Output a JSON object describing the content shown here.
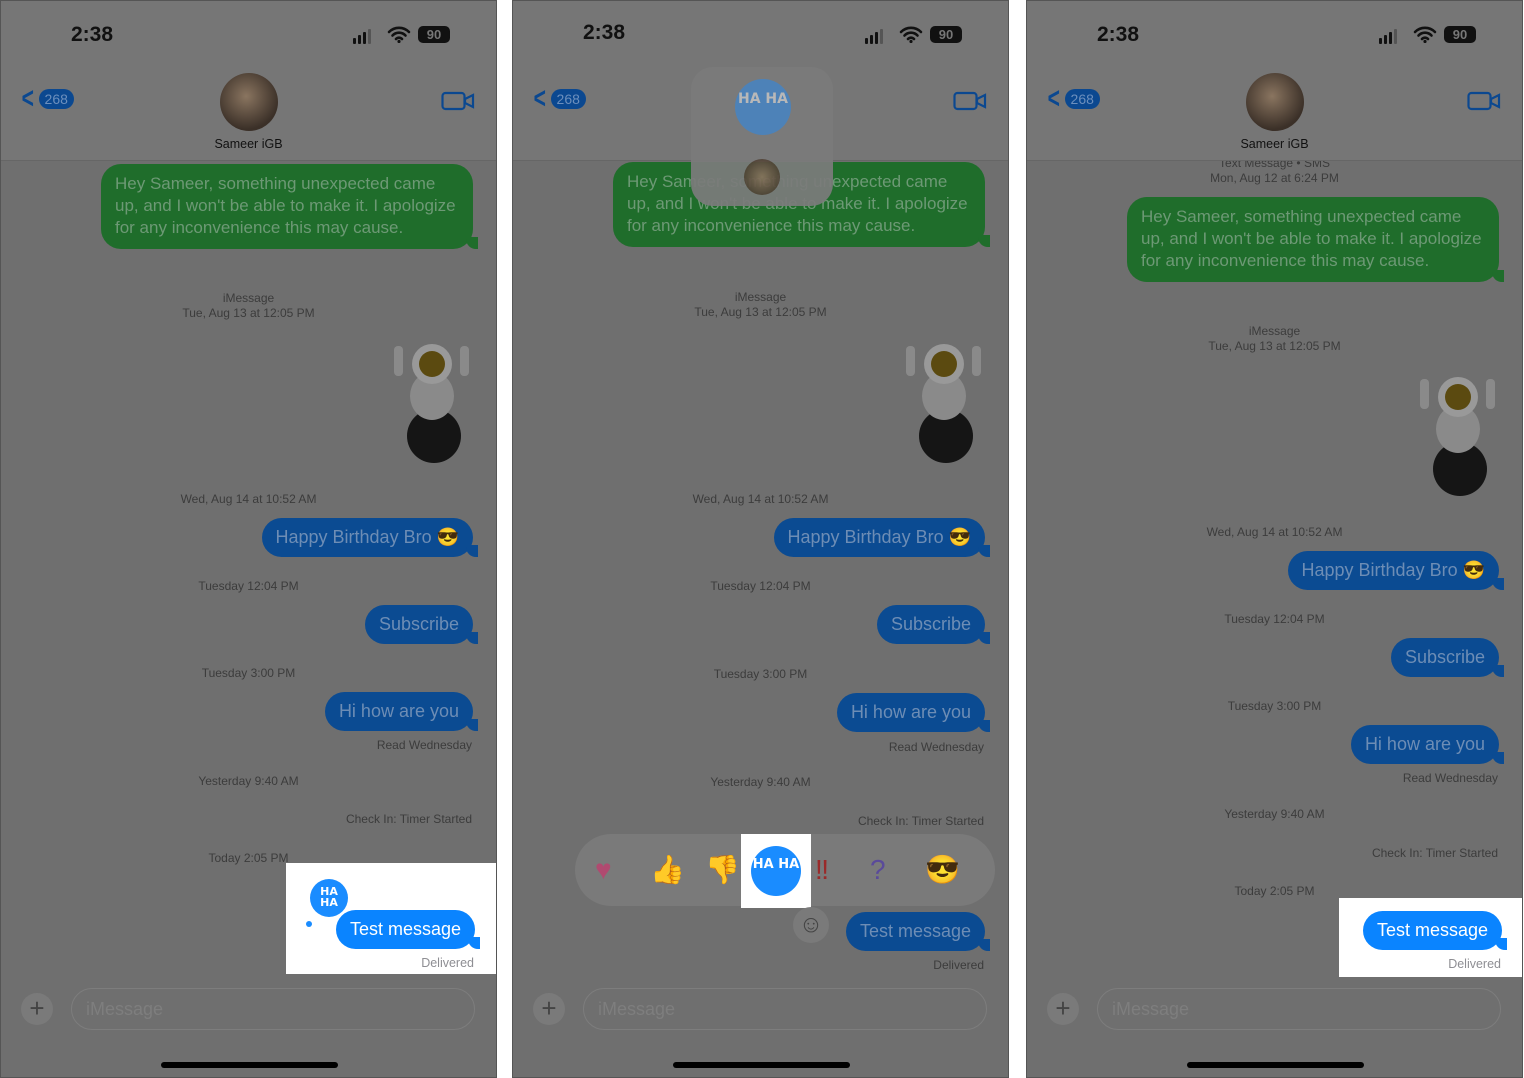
{
  "colors": {
    "imessage_blue": "#0a84ff",
    "sms_green": "#34c759",
    "dim_overlay": "#6f6f6f",
    "highlight": "#ffffff"
  },
  "panels": [
    {
      "status": {
        "time": "2:38",
        "battery": "90"
      },
      "header": {
        "back_count": "268",
        "contact": "Sameer iGB"
      },
      "items": [
        {
          "kind": "bubble",
          "color": "green",
          "text": "Hey Sameer, something unexpected came up, and I won't be able to make it. I apologize for any inconvenience this may cause."
        },
        {
          "kind": "ts",
          "text": "iMessage"
        },
        {
          "kind": "ts",
          "text": "Tue, Aug 13 at 12:05 PM"
        },
        {
          "kind": "sticker",
          "text": ""
        },
        {
          "kind": "ts",
          "text": "Wed, Aug 14 at 10:52 AM"
        },
        {
          "kind": "bubble",
          "color": "blue",
          "text": "Happy Birthday Bro 😎"
        },
        {
          "kind": "ts",
          "text": "Tuesday 12:04 PM"
        },
        {
          "kind": "bubble",
          "color": "blue",
          "text": "Subscribe"
        },
        {
          "kind": "ts",
          "text": "Tuesday 3:00 PM"
        },
        {
          "kind": "bubble",
          "color": "blue",
          "text": "Hi how are you"
        },
        {
          "kind": "st",
          "text": "Read Wednesday"
        },
        {
          "kind": "ts",
          "text": "Yesterday 9:40 AM"
        },
        {
          "kind": "st",
          "text": "Check In: Timer Started"
        },
        {
          "kind": "ts",
          "text": "Today 2:05 PM"
        }
      ],
      "highlight": {
        "message": "Test message",
        "status": "Delivered",
        "reaction": "HA HA",
        "reaction_icon": "haha-icon"
      },
      "input_placeholder": "iMessage"
    },
    {
      "status": {
        "time": "2:38",
        "battery": "90"
      },
      "header": {
        "back_count": "268",
        "contact": ""
      },
      "items": [
        {
          "kind": "bubble",
          "color": "green",
          "text": "Hey Sameer, something unexpected came up, and I won't be able to make it. I apologize for any inconvenience this may cause."
        },
        {
          "kind": "ts",
          "text": "iMessage"
        },
        {
          "kind": "ts",
          "text": "Tue, Aug 13 at 12:05 PM"
        },
        {
          "kind": "sticker",
          "text": ""
        },
        {
          "kind": "ts",
          "text": "Wed, Aug 14 at 10:52 AM"
        },
        {
          "kind": "bubble",
          "color": "blue",
          "text": "Happy Birthday Bro 😎"
        },
        {
          "kind": "ts",
          "text": "Tuesday 12:04 PM"
        },
        {
          "kind": "bubble",
          "color": "blue",
          "text": "Subscribe"
        },
        {
          "kind": "ts",
          "text": "Tuesday 3:00 PM"
        },
        {
          "kind": "bubble",
          "color": "blue",
          "text": "Hi how are you"
        },
        {
          "kind": "st",
          "text": "Read Wednesday"
        },
        {
          "kind": "ts",
          "text": "Yesterday 9:40 AM"
        },
        {
          "kind": "st",
          "text": "Check In: Timer Started"
        },
        {
          "kind": "bubble",
          "color": "blue",
          "text": "Test message"
        },
        {
          "kind": "st",
          "text": "Delivered"
        }
      ],
      "tapbacks": [
        {
          "icon": "heart-icon",
          "glyph": "♥"
        },
        {
          "icon": "thumbs-up-icon",
          "glyph": "👍"
        },
        {
          "icon": "thumbs-down-icon",
          "glyph": "👎"
        },
        {
          "icon": "haha-icon",
          "glyph": "HA HA",
          "selected": true
        },
        {
          "icon": "exclamation-icon",
          "glyph": "‼"
        },
        {
          "icon": "question-icon",
          "glyph": "?"
        },
        {
          "icon": "sunglasses-emoji-icon",
          "glyph": "😎"
        }
      ],
      "popup_reaction": "HA HA",
      "input_placeholder": "iMessage"
    },
    {
      "status": {
        "time": "2:38",
        "battery": "90"
      },
      "header": {
        "back_count": "268",
        "contact": "Sameer iGB"
      },
      "items": [
        {
          "kind": "ts",
          "text": "Text Message • SMS"
        },
        {
          "kind": "ts",
          "text": "Mon, Aug 12 at 6:24 PM"
        },
        {
          "kind": "bubble",
          "color": "green",
          "text": "Hey Sameer, something unexpected came up, and I won't be able to make it. I apologize for any inconvenience this may cause."
        },
        {
          "kind": "ts",
          "text": "iMessage"
        },
        {
          "kind": "ts",
          "text": "Tue, Aug 13 at 12:05 PM"
        },
        {
          "kind": "sticker",
          "text": ""
        },
        {
          "kind": "ts",
          "text": "Wed, Aug 14 at 10:52 AM"
        },
        {
          "kind": "bubble",
          "color": "blue",
          "text": "Happy Birthday Bro 😎"
        },
        {
          "kind": "ts",
          "text": "Tuesday 12:04 PM"
        },
        {
          "kind": "bubble",
          "color": "blue",
          "text": "Subscribe"
        },
        {
          "kind": "ts",
          "text": "Tuesday 3:00 PM"
        },
        {
          "kind": "bubble",
          "color": "blue",
          "text": "Hi how are you"
        },
        {
          "kind": "st",
          "text": "Read Wednesday"
        },
        {
          "kind": "ts",
          "text": "Yesterday 9:40 AM"
        },
        {
          "kind": "st",
          "text": "Check In: Timer Started"
        },
        {
          "kind": "ts",
          "text": "Today 2:05 PM"
        }
      ],
      "highlight": {
        "message": "Test message",
        "status": "Delivered"
      },
      "input_placeholder": "iMessage"
    }
  ]
}
